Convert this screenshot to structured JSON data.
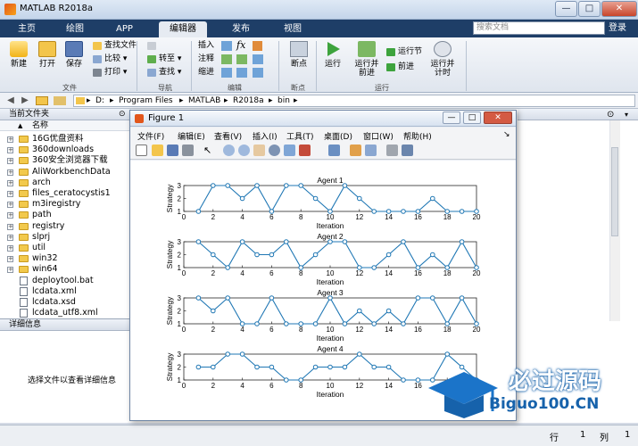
{
  "window": {
    "title": "MATLAB R2018a",
    "min": "—",
    "max": "□",
    "close": "✕"
  },
  "tabs": [
    "主页",
    "绘图",
    "APP",
    "编辑器",
    "发布",
    "视图"
  ],
  "active_tab": "编辑器",
  "search": {
    "placeholder": "搜索文档"
  },
  "login": "登录",
  "ribbon": {
    "file": {
      "new": "新建",
      "open": "打开",
      "save": "保存",
      "find_files": "查找文件",
      "compare": "比较",
      "print": "打印",
      "group": "文件"
    },
    "navigate": {
      "goto": "转至",
      "find": "查找",
      "group": "导航"
    },
    "edit": {
      "insert": "插入",
      "comment": "注释",
      "indent": "缩进",
      "group": "编辑"
    },
    "breakpoints": {
      "label": "断点",
      "group": "断点"
    },
    "run": {
      "run": "运行",
      "run_advance": "运行并\n前进",
      "run_section": "运行节",
      "advance": "前进",
      "run_time": "运行并\n计时",
      "group": "运行"
    }
  },
  "address": {
    "parts": [
      "D:",
      "Program Files",
      "MATLAB",
      "R2018a",
      "bin"
    ],
    "sep": "▸"
  },
  "current_folder": {
    "title": "当前文件夹",
    "col": "名称",
    "items": [
      {
        "name": "16G优盘资料",
        "type": "folder"
      },
      {
        "name": "360downloads",
        "type": "folder"
      },
      {
        "name": "360安全浏览器下载",
        "type": "folder"
      },
      {
        "name": "AliWorkbenchData",
        "type": "folder"
      },
      {
        "name": "arch",
        "type": "folder"
      },
      {
        "name": "files_ceratocystis1",
        "type": "folder"
      },
      {
        "name": "m3iregistry",
        "type": "folder"
      },
      {
        "name": "path",
        "type": "folder"
      },
      {
        "name": "registry",
        "type": "folder"
      },
      {
        "name": "slprj",
        "type": "folder"
      },
      {
        "name": "util",
        "type": "folder"
      },
      {
        "name": "win32",
        "type": "folder"
      },
      {
        "name": "win64",
        "type": "folder"
      },
      {
        "name": "deploytool.bat",
        "type": "file"
      },
      {
        "name": "lcdata.xml",
        "type": "file"
      },
      {
        "name": "lcdata.xsd",
        "type": "file"
      },
      {
        "name": "lcdata_utf8.xml",
        "type": "file"
      }
    ]
  },
  "details": {
    "title": "详细信息",
    "hint": "选择文件以查看详细信息"
  },
  "status": {
    "row_label": "行",
    "row": "1",
    "col_label": "列",
    "col": "1"
  },
  "figure": {
    "title": "Figure 1",
    "menus": [
      "文件(F)",
      "编辑(E)",
      "查看(V)",
      "插入(I)",
      "工具(T)",
      "桌面(D)",
      "窗口(W)",
      "帮助(H)"
    ]
  },
  "chart_data": [
    {
      "type": "line",
      "title": "Agent 1",
      "xlabel": "Iteration",
      "ylabel": "Strategy",
      "xlim": [
        0,
        20
      ],
      "ylim": [
        1,
        3
      ],
      "xticks": [
        0,
        2,
        4,
        6,
        8,
        10,
        12,
        14,
        16,
        18,
        20
      ],
      "yticks": [
        1,
        2,
        3
      ],
      "x": [
        1,
        2,
        3,
        4,
        5,
        6,
        7,
        8,
        9,
        10,
        11,
        12,
        13,
        14,
        15,
        16,
        17,
        18,
        19,
        20
      ],
      "values": [
        1,
        3,
        3,
        2,
        3,
        1,
        3,
        3,
        2,
        1,
        3,
        2,
        1,
        1,
        1,
        1,
        2,
        1,
        1,
        1
      ]
    },
    {
      "type": "line",
      "title": "Agent 2",
      "xlabel": "Iteration",
      "ylabel": "Strategy",
      "xlim": [
        0,
        20
      ],
      "ylim": [
        1,
        3
      ],
      "xticks": [
        0,
        2,
        4,
        6,
        8,
        10,
        12,
        14,
        16,
        18,
        20
      ],
      "yticks": [
        1,
        2,
        3
      ],
      "x": [
        1,
        2,
        3,
        4,
        5,
        6,
        7,
        8,
        9,
        10,
        11,
        12,
        13,
        14,
        15,
        16,
        17,
        18,
        19,
        20
      ],
      "values": [
        3,
        2,
        1,
        3,
        2,
        2,
        3,
        1,
        2,
        3,
        3,
        1,
        1,
        2,
        3,
        1,
        2,
        1,
        3,
        1
      ]
    },
    {
      "type": "line",
      "title": "Agent 3",
      "xlabel": "Iteration",
      "ylabel": "Strategy",
      "xlim": [
        0,
        20
      ],
      "ylim": [
        1,
        3
      ],
      "xticks": [
        0,
        2,
        4,
        6,
        8,
        10,
        12,
        14,
        16,
        18,
        20
      ],
      "yticks": [
        1,
        2,
        3
      ],
      "x": [
        1,
        2,
        3,
        4,
        5,
        6,
        7,
        8,
        9,
        10,
        11,
        12,
        13,
        14,
        15,
        16,
        17,
        18,
        19,
        20
      ],
      "values": [
        3,
        2,
        3,
        1,
        1,
        3,
        1,
        1,
        1,
        3,
        1,
        2,
        1,
        2,
        1,
        3,
        3,
        1,
        3,
        1
      ]
    },
    {
      "type": "line",
      "title": "Agent 4",
      "xlabel": "Iteration",
      "ylabel": "Strategy",
      "xlim": [
        0,
        20
      ],
      "ylim": [
        1,
        3
      ],
      "xticks": [
        0,
        2,
        4,
        6,
        8,
        10,
        12,
        14,
        16,
        18,
        20
      ],
      "yticks": [
        1,
        2,
        3
      ],
      "x": [
        1,
        2,
        3,
        4,
        5,
        6,
        7,
        8,
        9,
        10,
        11,
        12,
        13,
        14,
        15,
        16,
        17,
        18,
        19,
        20
      ],
      "values": [
        2,
        2,
        3,
        3,
        2,
        2,
        1,
        1,
        2,
        2,
        2,
        3,
        2,
        2,
        1,
        1,
        1,
        3,
        2,
        1
      ]
    }
  ],
  "watermark": {
    "line1": "必过源码",
    "line2": "Biguo100.CN"
  },
  "colors": {
    "line": "#1f77b4",
    "ribbon_tab_bg": "#1e3e67",
    "accent_orange": "#e2561b"
  }
}
